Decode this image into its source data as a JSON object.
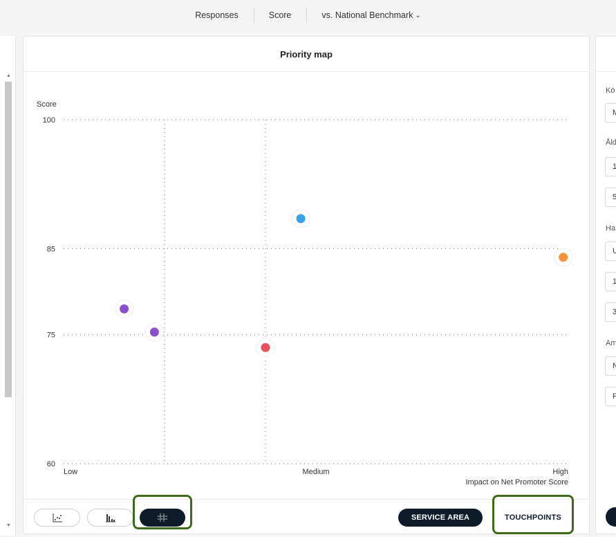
{
  "tabs": [
    {
      "label": "Responses"
    },
    {
      "label": "Score"
    },
    {
      "label": "vs. National Benchmark"
    }
  ],
  "card": {
    "title": "Priority map"
  },
  "chart_data": {
    "type": "scatter",
    "ylabel": "Score",
    "xlabel": "Impact on Net Promoter Score",
    "x_tick_labels": [
      "Low",
      "Medium",
      "High"
    ],
    "y_ticks": [
      60,
      75,
      85,
      100
    ],
    "ylim": [
      60,
      100
    ],
    "xlim": [
      0,
      1
    ],
    "x_dividers": [
      0.2,
      0.4
    ],
    "grid": "dotted",
    "points": [
      {
        "x": 0.12,
        "y": 78.0,
        "color": "#8a4fcf"
      },
      {
        "x": 0.18,
        "y": 75.3,
        "color": "#8a4fcf"
      },
      {
        "x": 0.4,
        "y": 73.5,
        "color": "#e8505b"
      },
      {
        "x": 0.47,
        "y": 88.5,
        "color": "#3aa0ea"
      },
      {
        "x": 0.99,
        "y": 84.0,
        "color": "#f7923a"
      }
    ]
  },
  "footer": {
    "view_icons": [
      "scatter-chart-icon",
      "bar-chart-icon",
      "priority-grid-icon"
    ],
    "service_area_label": "SERVICE AREA",
    "touchpoints_label": "TOUCHPOINTS"
  },
  "right_panel": {
    "labels": [
      "Kö",
      "Åld",
      "Ha",
      "Am"
    ],
    "fields": [
      "M",
      "1",
      "5",
      "U",
      "1",
      "3",
      "N",
      "F"
    ]
  },
  "colors": {
    "dark_navy": "#0d1b2a",
    "highlight_green": "#3d6b1a"
  }
}
